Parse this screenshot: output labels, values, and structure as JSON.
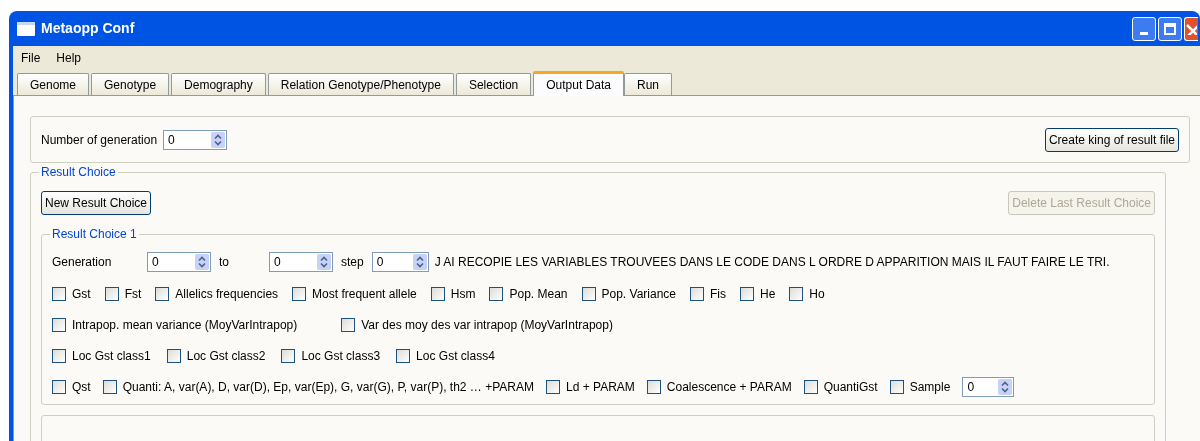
{
  "window": {
    "title": "Metaopp Conf"
  },
  "menu": [
    "File",
    "Help"
  ],
  "tabs": [
    {
      "label": "Genome",
      "selected": false
    },
    {
      "label": "Genotype",
      "selected": false
    },
    {
      "label": "Demography",
      "selected": false
    },
    {
      "label": "Relation Genotype/Phenotype",
      "selected": false
    },
    {
      "label": "Selection",
      "selected": false
    },
    {
      "label": "Output Data",
      "selected": true
    },
    {
      "label": "Run",
      "selected": false
    }
  ],
  "generations": {
    "label": "Number of generation",
    "value": "0",
    "button": "Create king of result file"
  },
  "result_choice": {
    "title": "Result Choice",
    "new_button": {
      "label": "New Result Choice",
      "disabled": false
    },
    "delete_button": {
      "label": "Delete Last Result Choice",
      "disabled": true
    },
    "choice": {
      "title": "Result Choice 1",
      "generation": {
        "label": "Generation",
        "from": "0",
        "to_label": "to",
        "to": "0",
        "step_label": "step",
        "step": "0",
        "note": "J AI RECOPIE LES VARIABLES TROUVEES DANS LE CODE DANS L ORDRE D APPARITION MAIS IL FAUT FAIRE LE TRI."
      },
      "rows": [
        {
          "items": [
            {
              "kind": "checkbox",
              "label": "Gst",
              "checked": false
            },
            {
              "kind": "checkbox",
              "label": "Fst",
              "checked": false
            },
            {
              "kind": "checkbox",
              "label": "Allelics frequencies",
              "checked": false
            },
            {
              "kind": "checkbox",
              "label": "Most frequent allele",
              "checked": false
            },
            {
              "kind": "checkbox",
              "label": "Hsm",
              "checked": false
            },
            {
              "kind": "checkbox",
              "label": "Pop. Mean",
              "checked": false
            },
            {
              "kind": "checkbox",
              "label": "Pop. Variance",
              "checked": false
            },
            {
              "kind": "checkbox",
              "label": "Fis",
              "checked": false
            },
            {
              "kind": "checkbox",
              "label": "He",
              "checked": false
            },
            {
              "kind": "checkbox",
              "label": "Ho",
              "checked": false
            }
          ]
        },
        {
          "items": [
            {
              "kind": "checkbox",
              "label": "Intrapop. mean variance (MoyVarIntrapop)",
              "checked": false
            },
            {
              "kind": "checkbox",
              "label": "Var des moy des var intrapop (MoyVarIntrapop)",
              "checked": false
            }
          ]
        },
        {
          "items": [
            {
              "kind": "checkbox",
              "label": "Loc Gst class1",
              "checked": false
            },
            {
              "kind": "checkbox",
              "label": "Loc Gst class2",
              "checked": false
            },
            {
              "kind": "checkbox",
              "label": "Loc Gst class3",
              "checked": false
            },
            {
              "kind": "checkbox",
              "label": "Loc Gst class4",
              "checked": false
            }
          ]
        },
        {
          "items": [
            {
              "kind": "checkbox",
              "label": "Qst",
              "checked": false
            },
            {
              "kind": "checkbox",
              "label": "Quanti:  A, var(A), D, var(D), Ep, var(Ep), G, var(G), P, var(P), th2  … +PARAM",
              "checked": false
            },
            {
              "kind": "checkbox",
              "label": "Ld + PARAM",
              "checked": false
            },
            {
              "kind": "checkbox",
              "label": "Coalescence + PARAM",
              "checked": false
            },
            {
              "kind": "checkbox",
              "label": "QuantiGst",
              "checked": false
            },
            {
              "kind": "checkbox",
              "label": "Sample",
              "checked": false
            },
            {
              "kind": "spinner",
              "value": "0"
            }
          ]
        }
      ]
    }
  }
}
